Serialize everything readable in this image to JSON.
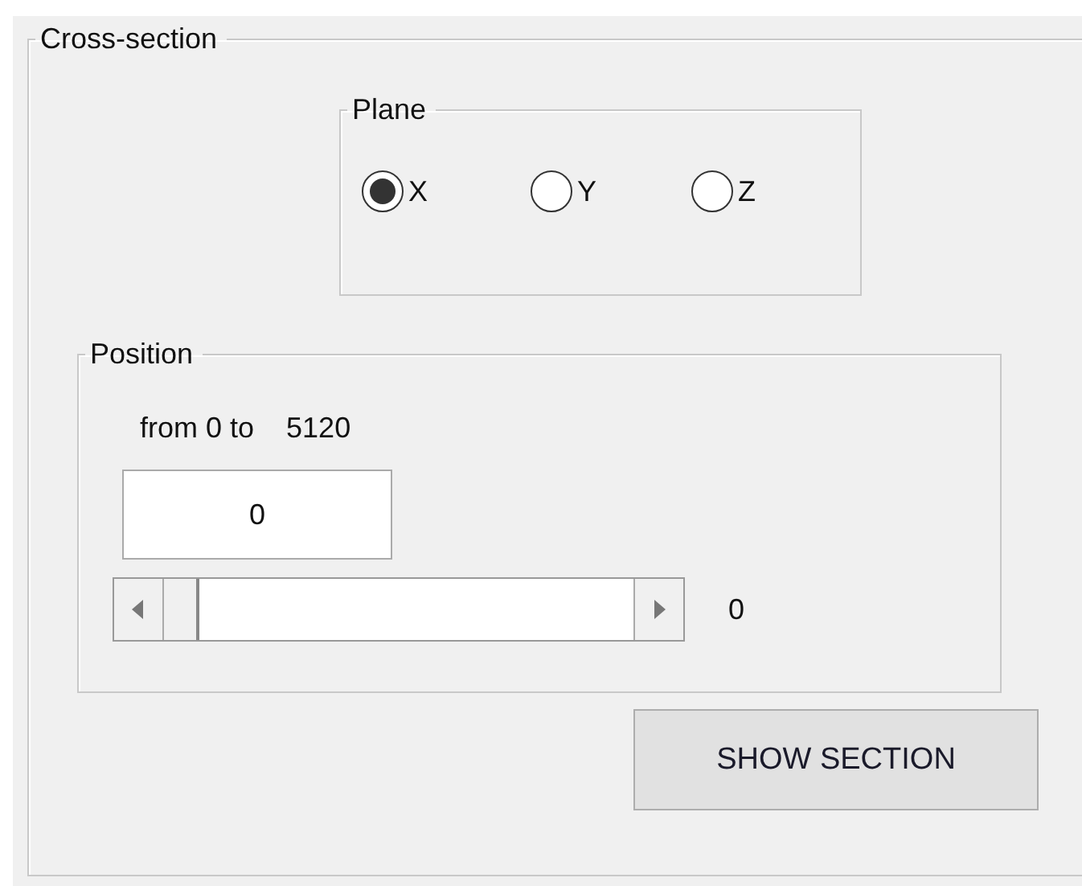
{
  "group": {
    "title": "Cross-section"
  },
  "plane": {
    "title": "Plane",
    "options": [
      {
        "label": "X",
        "selected": true
      },
      {
        "label": "Y",
        "selected": false
      },
      {
        "label": "Z",
        "selected": false
      }
    ]
  },
  "position": {
    "title": "Position",
    "range_label": "from 0 to",
    "range_max": "5120",
    "value": "0",
    "slider": {
      "level": 0
    },
    "reading": "0"
  },
  "button": "SHOW SECTION"
}
